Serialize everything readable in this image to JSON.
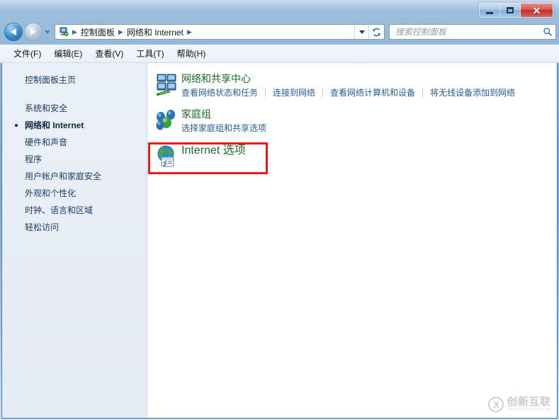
{
  "window": {
    "controls": {
      "minimize_label": "最小化",
      "maximize_label": "最大化",
      "close_label": "✕"
    }
  },
  "navbar": {
    "back_label": "后退",
    "forward_label": "前进",
    "history_label": "最近浏览的位置",
    "address_icon": "control-panel-icon",
    "breadcrumbs": [
      {
        "label": "控制面板"
      },
      {
        "label": "网络和 Internet"
      }
    ],
    "separator": "▶",
    "dropdown_label": "以前的位置",
    "refresh_label": "刷新"
  },
  "search": {
    "placeholder": "搜索控制面板",
    "value": "",
    "icon": "search-icon"
  },
  "menubar": {
    "items": [
      {
        "label": "文件(F)"
      },
      {
        "label": "编辑(E)"
      },
      {
        "label": "查看(V)"
      },
      {
        "label": "工具(T)"
      },
      {
        "label": "帮助(H)"
      }
    ]
  },
  "sidebar": {
    "home": {
      "label": "控制面板主页"
    },
    "items": [
      {
        "label": "系统和安全",
        "selected": false
      },
      {
        "label": "网络和 Internet",
        "selected": true
      },
      {
        "label": "硬件和声音",
        "selected": false
      },
      {
        "label": "程序",
        "selected": false
      },
      {
        "label": "用户帐户和家庭安全",
        "selected": false
      },
      {
        "label": "外观和个性化",
        "selected": false
      },
      {
        "label": "时钟、语言和区域",
        "selected": false
      },
      {
        "label": "轻松访问",
        "selected": false
      }
    ]
  },
  "main": {
    "categories": [
      {
        "title": "网络和共享中心",
        "icon": "network-sharing-center-icon",
        "links": [
          {
            "label": "查看网络状态和任务"
          },
          {
            "label": "连接到网络"
          },
          {
            "label": "查看网络计算机和设备"
          },
          {
            "label": "将无线设备添加到网络"
          }
        ]
      },
      {
        "title": "家庭组",
        "icon": "homegroup-icon",
        "links": [
          {
            "label": "选择家庭组和共享选项"
          }
        ]
      },
      {
        "title": "Internet 选项",
        "icon": "internet-options-icon",
        "links": []
      }
    ]
  },
  "annotation": {
    "highlight_color": "#e81b1b",
    "target": "Internet 选项"
  },
  "watermark": {
    "logo_glyph": "X",
    "text": "创新互联",
    "subtext": "CHUANGXIN HULIAN"
  },
  "colors": {
    "category_title": "#1d6a23",
    "category_link": "#2a5d96",
    "sidebar_text": "#1f3c63",
    "highlight": "#e81b1b"
  }
}
